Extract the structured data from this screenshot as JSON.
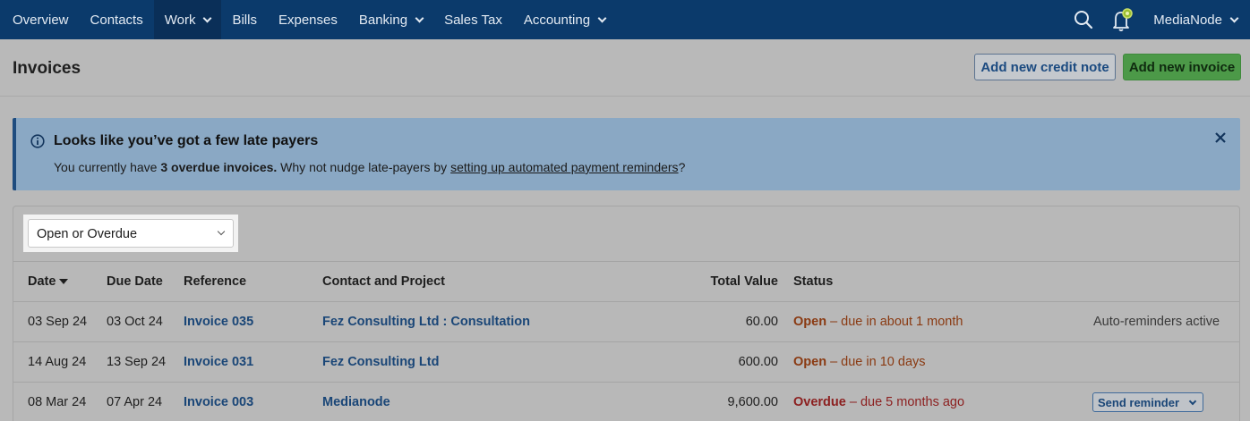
{
  "nav": {
    "items": [
      {
        "label": "Overview"
      },
      {
        "label": "Contacts"
      },
      {
        "label": "Work"
      },
      {
        "label": "Bills"
      },
      {
        "label": "Expenses"
      },
      {
        "label": "Banking"
      },
      {
        "label": "Sales Tax"
      },
      {
        "label": "Accounting"
      }
    ],
    "account": "MediaNode"
  },
  "header": {
    "title": "Invoices",
    "credit_note_button": "Add new credit note",
    "new_invoice_button": "Add new invoice"
  },
  "alert": {
    "title": "Looks like you’ve got a few late payers",
    "text_before": "You currently have ",
    "text_bold": "3 overdue invoices.",
    "text_middle": " Why not nudge late-payers by ",
    "link": "setting up automated payment reminders",
    "text_after": "?"
  },
  "filter": {
    "selected": "Open or Overdue"
  },
  "table": {
    "headers": {
      "date": "Date",
      "due_date": "Due Date",
      "reference": "Reference",
      "contact": "Contact and Project",
      "total": "Total Value",
      "status": "Status"
    },
    "rows": [
      {
        "date": "03 Sep 24",
        "due_date": "03 Oct 24",
        "reference": "Invoice 035",
        "contact": "Fez Consulting Ltd : Consultation",
        "total": "60.00",
        "status_word": "Open",
        "status_detail": " – due in about 1 month",
        "extra": "Auto-reminders active"
      },
      {
        "date": "14 Aug 24",
        "due_date": "13 Sep 24",
        "reference": "Invoice 031",
        "contact": "Fez Consulting Ltd",
        "total": "600.00",
        "status_word": "Open",
        "status_detail": " – due in 10 days",
        "extra": ""
      },
      {
        "date": "08 Mar 24",
        "due_date": "07 Apr 24",
        "reference": "Invoice 003",
        "contact": "Medianode",
        "total": "9,600.00",
        "status_word": "Overdue",
        "status_detail": " – due 5 months ago",
        "extra": "Send reminder"
      }
    ]
  }
}
